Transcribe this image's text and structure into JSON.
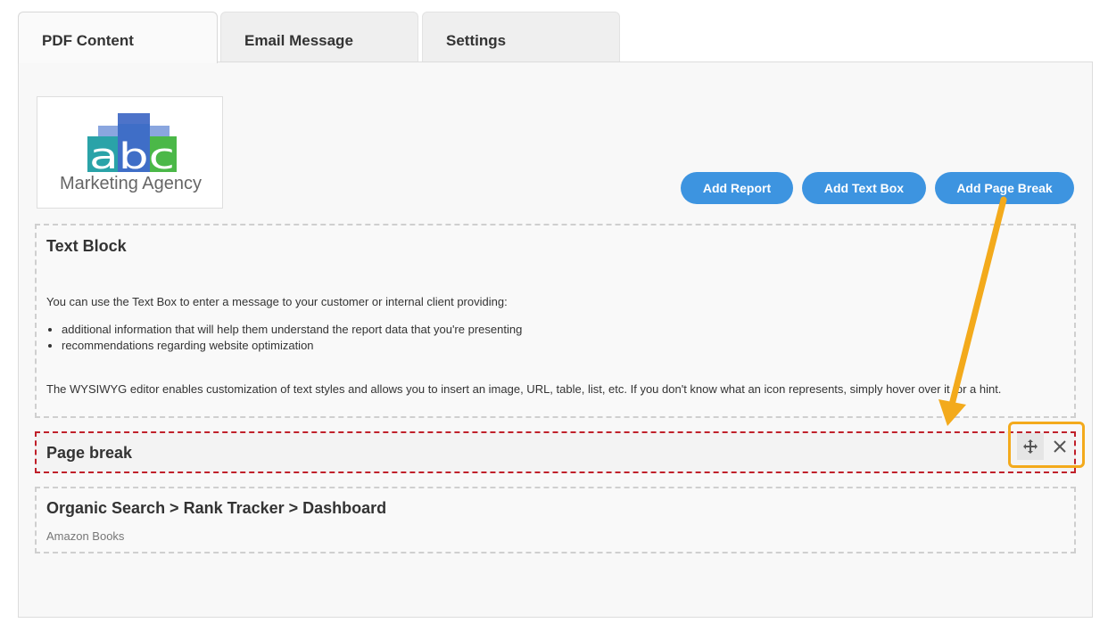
{
  "tabs": [
    {
      "label": "PDF Content",
      "active": true
    },
    {
      "label": "Email Message",
      "active": false
    },
    {
      "label": "Settings",
      "active": false
    }
  ],
  "logo": {
    "letters": "abc",
    "caption": "Marketing Agency",
    "colors": {
      "a": "#2aa3a8",
      "b": "#3f6ec7",
      "c": "#4bb848",
      "bar_light": "#8aa6df",
      "bar_dark": "#4d73c9"
    }
  },
  "actions": {
    "add_report": "Add Report",
    "add_text_box": "Add Text Box",
    "add_page_break": "Add Page Break"
  },
  "text_block": {
    "title": "Text Block",
    "intro": "You can use the Text Box to enter a message to your customer or internal client providing:",
    "bullets": [
      "additional information that will help them understand the report data that you're presenting",
      "recommendations regarding website optimization"
    ],
    "outro": "The WYSIWYG editor enables customization of text styles and allows you to insert an image, URL, table, list, etc. If you don't know what an icon represents, simply hover over it for a hint."
  },
  "page_break": {
    "title": "Page break",
    "move_icon": "move-icon",
    "close_icon": "close-icon"
  },
  "report_block": {
    "title": "Organic Search > Rank Tracker > Dashboard",
    "subtitle": "Amazon Books"
  },
  "colors": {
    "button": "#3d94e0",
    "highlight": "#f3aa1c",
    "page_break_border": "#c0202a"
  }
}
